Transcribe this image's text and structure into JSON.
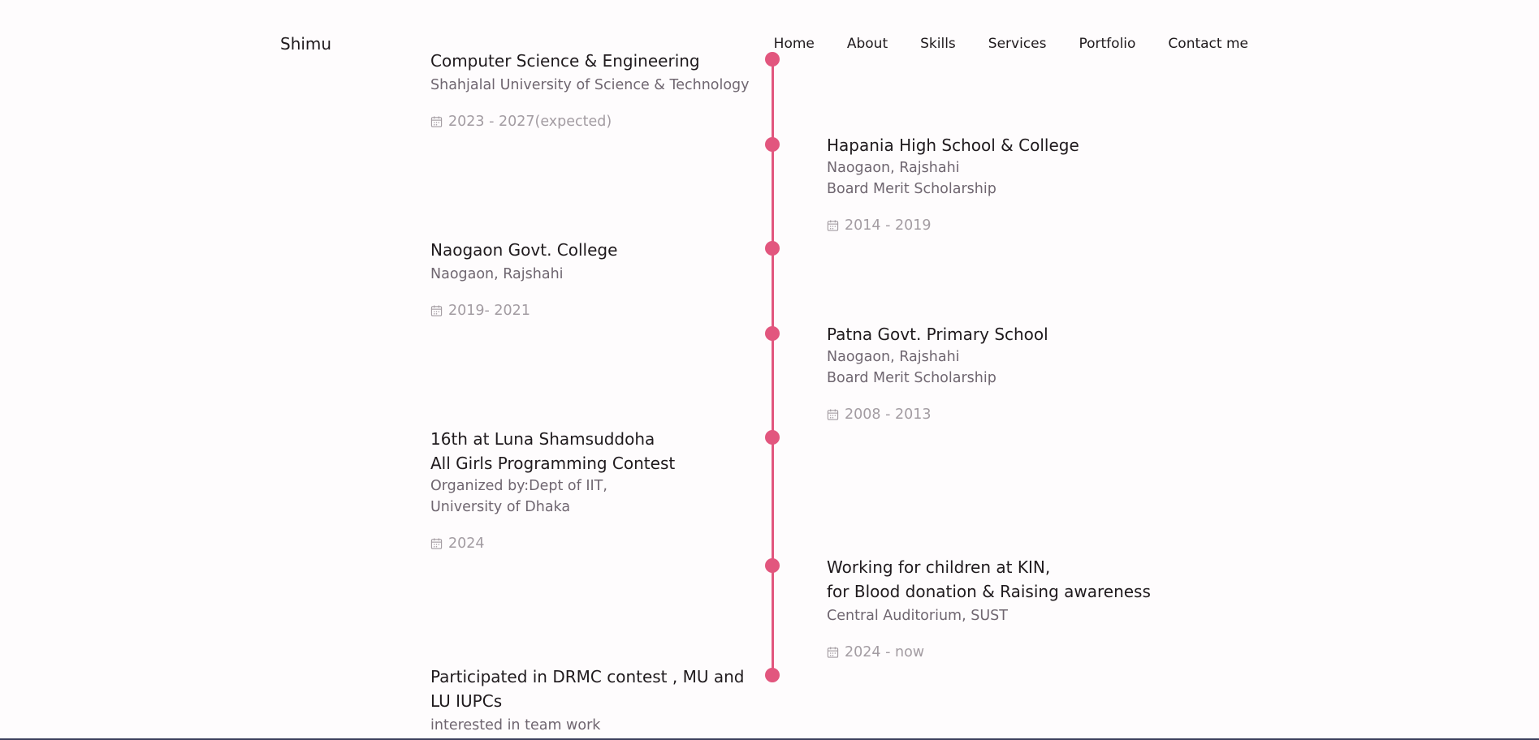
{
  "header": {
    "logo": "Shimu",
    "nav": [
      "Home",
      "About",
      "Skills",
      "Services",
      "Portfolio",
      "Contact me"
    ]
  },
  "timeline": {
    "accent_color": "#e2567e",
    "items": [
      {
        "side": "left",
        "title": "Computer Science & Engineering",
        "lines": [
          "Shahjalal University of Science & Technology"
        ],
        "date": "2023 - 2027(expected)"
      },
      {
        "side": "right",
        "title": "Hapania High School & College",
        "lines": [
          "Naogaon, Rajshahi",
          "Board Merit Scholarship"
        ],
        "date": "2014 - 2019"
      },
      {
        "side": "left",
        "title": "Naogaon Govt. College",
        "lines": [
          "Naogaon, Rajshahi"
        ],
        "date": "2019- 2021"
      },
      {
        "side": "right",
        "title": "Patna Govt. Primary School",
        "lines": [
          "Naogaon, Rajshahi",
          "Board Merit Scholarship"
        ],
        "date": "2008 - 2013"
      },
      {
        "side": "left",
        "title_lines": [
          "16th at Luna Shamsuddoha",
          "All Girls Programming Contest"
        ],
        "lines": [
          "Organized by:Dept of IIT,",
          "University of Dhaka"
        ],
        "date": "2024"
      },
      {
        "side": "right",
        "title_lines": [
          "Working for children at KIN,",
          "for Blood donation & Raising awareness"
        ],
        "lines": [
          "Central Auditorium, SUST"
        ],
        "date": "2024 - now"
      },
      {
        "side": "left",
        "title_lines": [
          "Participated in DRMC contest , MU and",
          "LU IUPCs"
        ],
        "lines": [
          "interested in team work"
        ]
      }
    ]
  },
  "icons": {
    "calendar": "calendar-icon"
  }
}
